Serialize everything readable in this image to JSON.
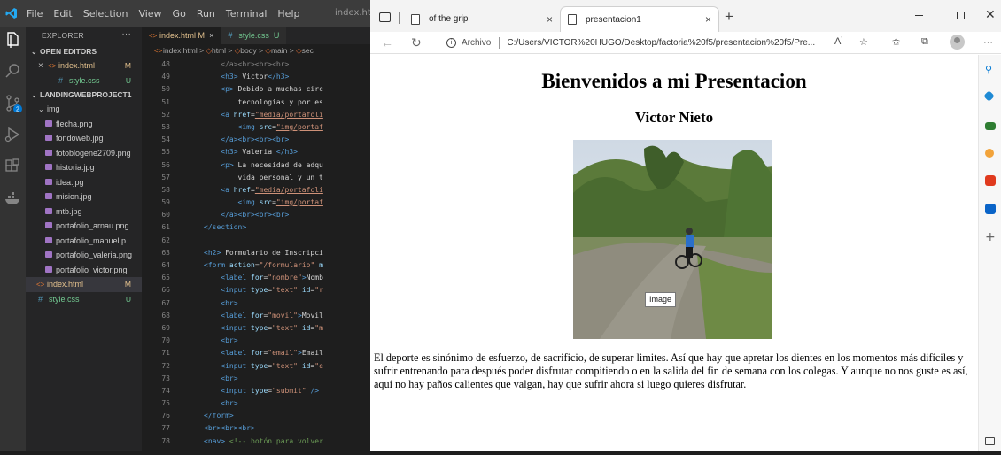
{
  "vscode": {
    "menu": [
      "File",
      "Edit",
      "Selection",
      "View",
      "Go",
      "Run",
      "Terminal",
      "Help"
    ],
    "title": "index.html",
    "explorer_title": "EXPLORER",
    "explorer_dots": "···",
    "open_editors": {
      "label": "OPEN EDITORS",
      "items": [
        {
          "name": "index.html",
          "badge": "M",
          "kind": "html"
        },
        {
          "name": "style.css",
          "badge": "U",
          "kind": "css"
        }
      ]
    },
    "project": {
      "label": "LANDINGWEBPROJECT1",
      "folder": "img",
      "files": [
        "flecha.png",
        "fondoweb.jpg",
        "fotoblogene2709.png",
        "historia.jpg",
        "idea.jpg",
        "mision.jpg",
        "mtb.jpg",
        "portafolio_arnau.png",
        "portafolio_manuel.p...",
        "portafolio_valeria.png",
        "portafolio_victor.png"
      ],
      "root_files": [
        {
          "name": "index.html",
          "badge": "M",
          "kind": "html"
        },
        {
          "name": "style.css",
          "badge": "U",
          "kind": "css"
        }
      ]
    },
    "tabs": [
      {
        "label": "index.html",
        "badge": "M",
        "close": "×"
      },
      {
        "label": "style.css",
        "badge": "U"
      }
    ],
    "breadcrumb": [
      "index.html",
      "html",
      "body",
      "main",
      "sec"
    ],
    "code_lines": [
      {
        "n": "48"
      },
      {
        "n": "49"
      },
      {
        "n": "50"
      },
      {
        "n": "51"
      },
      {
        "n": "52"
      },
      {
        "n": "53"
      },
      {
        "n": "54"
      },
      {
        "n": "55"
      },
      {
        "n": "56"
      },
      {
        "n": "57"
      },
      {
        "n": "58"
      },
      {
        "n": "59"
      },
      {
        "n": "60"
      },
      {
        "n": "61"
      },
      {
        "n": "62"
      },
      {
        "n": "63"
      },
      {
        "n": "64"
      },
      {
        "n": "65"
      },
      {
        "n": "66"
      },
      {
        "n": "67"
      },
      {
        "n": "68"
      },
      {
        "n": "69"
      },
      {
        "n": "70"
      },
      {
        "n": "71"
      },
      {
        "n": "72"
      },
      {
        "n": "73"
      },
      {
        "n": "74"
      },
      {
        "n": "75"
      },
      {
        "n": "76"
      },
      {
        "n": "77"
      },
      {
        "n": "78"
      }
    ],
    "code_text": {
      "l48": "</a><br><br><br>",
      "l49_tag": "<h3>",
      "l49_text": " Victor",
      "l49_end": "</h3>",
      "l50_text": " Debido a muchas circ",
      "l51_text": "tecnologias y por es",
      "l52_href": "\"media/portafoli",
      "l53_src": "\"img/portaf",
      "l55_text": " Valeria ",
      "l56_text": " La necesidad de adqu",
      "l57_text": "vida personal y un t",
      "l58_href": "\"media/portafoli",
      "l59_src": "\"img/portaf",
      "l63_text": " Formulario de Inscripci",
      "l64_action": "\"/formulario\"",
      "l65_for": "\"nombre\"",
      "l65_text": "Nomb",
      "l66_type": "\"text\"",
      "l66_id": "\"r",
      "l68_for": "\"movil\"",
      "l68_text": "Movil",
      "l69_type": "\"text\"",
      "l69_id": "\"m",
      "l71_for": "\"email\"",
      "l71_text": "Email",
      "l72_type": "\"text\"",
      "l72_id": "\"e",
      "l74_type": "\"submit\"",
      "l78_comment": "<!-- botón para volver"
    }
  },
  "edge": {
    "tabs": [
      {
        "label": "of the grip",
        "close": "×"
      },
      {
        "label": "presentacion1",
        "close": "×"
      }
    ],
    "new_tab": "+",
    "address_prefix": "Archivo",
    "address_url": "C:/Users/VICTOR%20HUGO/Desktop/factoria%20f5/presentacion%20f5/Pre...",
    "page": {
      "h1": "Bienvenidos a mi Presentacion",
      "h2": "Victor Nieto",
      "image_tooltip": "Image",
      "paragraph": "El deporte es sinónimo de esfuerzo, de sacrificio, de superar limites. Así que hay que apretar los dientes en los momentos más difíciles y sufrir entrenando para después poder disfrutar compitiendo o en la salida del fin de semana con los colegas. Y aunque no nos guste es así, aquí no hay paños calientes que valgan, hay que sufrir ahora si luego quieres disfrutar."
    }
  },
  "colors": {
    "vscode_bg": "#1e1e1e",
    "vscode_sidebar": "#252526",
    "modified": "#e2c08d",
    "untracked": "#73c991",
    "accent": "#007acc"
  }
}
